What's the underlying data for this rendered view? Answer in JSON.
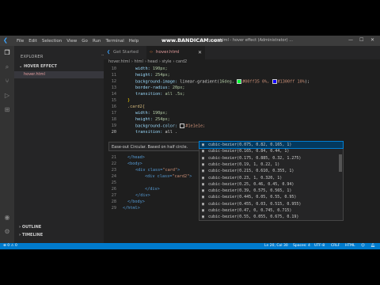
{
  "title_bar": {
    "menu": [
      "File",
      "Edit",
      "Selection",
      "View",
      "Go",
      "Run",
      "Terminal",
      "Help"
    ],
    "recorder": "www.BANDICAM.com",
    "window_title": "hover.html - hover effect (Administrator) ..."
  },
  "sidebar": {
    "header": "EXPLORER",
    "dots": "···",
    "folder": "HOVER EFFECT",
    "file": "hover.html",
    "outline": "OUTLINE",
    "timeline": "TIMELINE"
  },
  "tabs": [
    {
      "label": "Get Started"
    },
    {
      "label": "hover.html"
    }
  ],
  "breadcrumb": [
    "hover.html",
    "html",
    "head",
    "style",
    "card2"
  ],
  "hint": "Ease-out Circular. Based on half circle.",
  "suggestions": [
    "cubic-bezier(0.075, 0.82, 0.165, 1)",
    "cubic-bezier(0.165, 0.84, 0.44, 1)",
    "cubic-bezier(0.175, 0.885, 0.32, 1.275)",
    "cubic-bezier(0.19, 1, 0.22, 1)",
    "cubic-bezier(0.215, 0.610, 0.355, 1)",
    "cubic-bezier(0.23, 1, 0.320, 1)",
    "cubic-bezier(0.25, 0.46, 0.45, 0.94)",
    "cubic-bezier(0.39, 0.575, 0.565, 1)",
    "cubic-bezier(0.445, 0.05, 0.55, 0.95)",
    "cubic-bezier(0.455, 0.03, 0.515, 0.955)",
    "cubic-bezier(0.47, 0, 0.745, 0.715)",
    "cubic-bezier(0.55, 0.055, 0.675, 0.19)"
  ],
  "code": {
    "l10": {
      "n": "10",
      "prop": "width:",
      "val": " 190px;"
    },
    "l11": {
      "n": "11",
      "prop": "height:",
      "val": " 254px;"
    },
    "l12": {
      "n": "12",
      "prop": "background-image:",
      "a": " linear-gradient(",
      "b": "16deg, ",
      "c": "#00ff35 0%, ",
      "d": "#1300ff 10%",
      "e": ");"
    },
    "l13": {
      "n": "13",
      "prop": "border-radius:",
      "val": " 20px;"
    },
    "l14": {
      "n": "14",
      "prop": "transition:",
      "val": " all .5s;"
    },
    "l15": {
      "n": "15",
      "text": "}"
    },
    "l16": {
      "n": "16",
      "text": ".card2{"
    },
    "l17": {
      "n": "17",
      "prop": "width:",
      "val": " 190px;"
    },
    "l18": {
      "n": "18",
      "prop": "height:",
      "val": " 254px;"
    },
    "l19": {
      "n": "19",
      "prop": "background-color:",
      "val": "#1e1e1e;"
    },
    "l20": {
      "n": "20",
      "prop": "transition:",
      "val": " all ."
    },
    "l21": {
      "n": "21",
      "text": "</head>"
    },
    "l22": {
      "n": "22",
      "text": "<body>"
    },
    "l23": {
      "n": "23",
      "a": "<div class=",
      "b": "\"card\"",
      "c": ">"
    },
    "l24": {
      "n": "24",
      "a": "<div class=",
      "b": "\"card2\"",
      "c": ">"
    },
    "l25": {
      "n": "25",
      "text": ""
    },
    "l26": {
      "n": "26",
      "text": "</div>"
    },
    "l27": {
      "n": "27",
      "text": "</div>"
    },
    "l28": {
      "n": "28",
      "text": "</body>"
    },
    "l29": {
      "n": "29",
      "text": "</html>"
    }
  },
  "status": {
    "errors": "⊗ 0 ⚠ 0",
    "position": "Ln 20, Col 30",
    "spaces": "Spaces: 4",
    "encoding": "UTF-8",
    "eol": "CRLF",
    "language": "HTML"
  },
  "colors": {
    "accent": "#007acc",
    "swatch1": "#00ff35",
    "swatch2": "#1300ff",
    "swatch3": "#1e1e1e"
  }
}
